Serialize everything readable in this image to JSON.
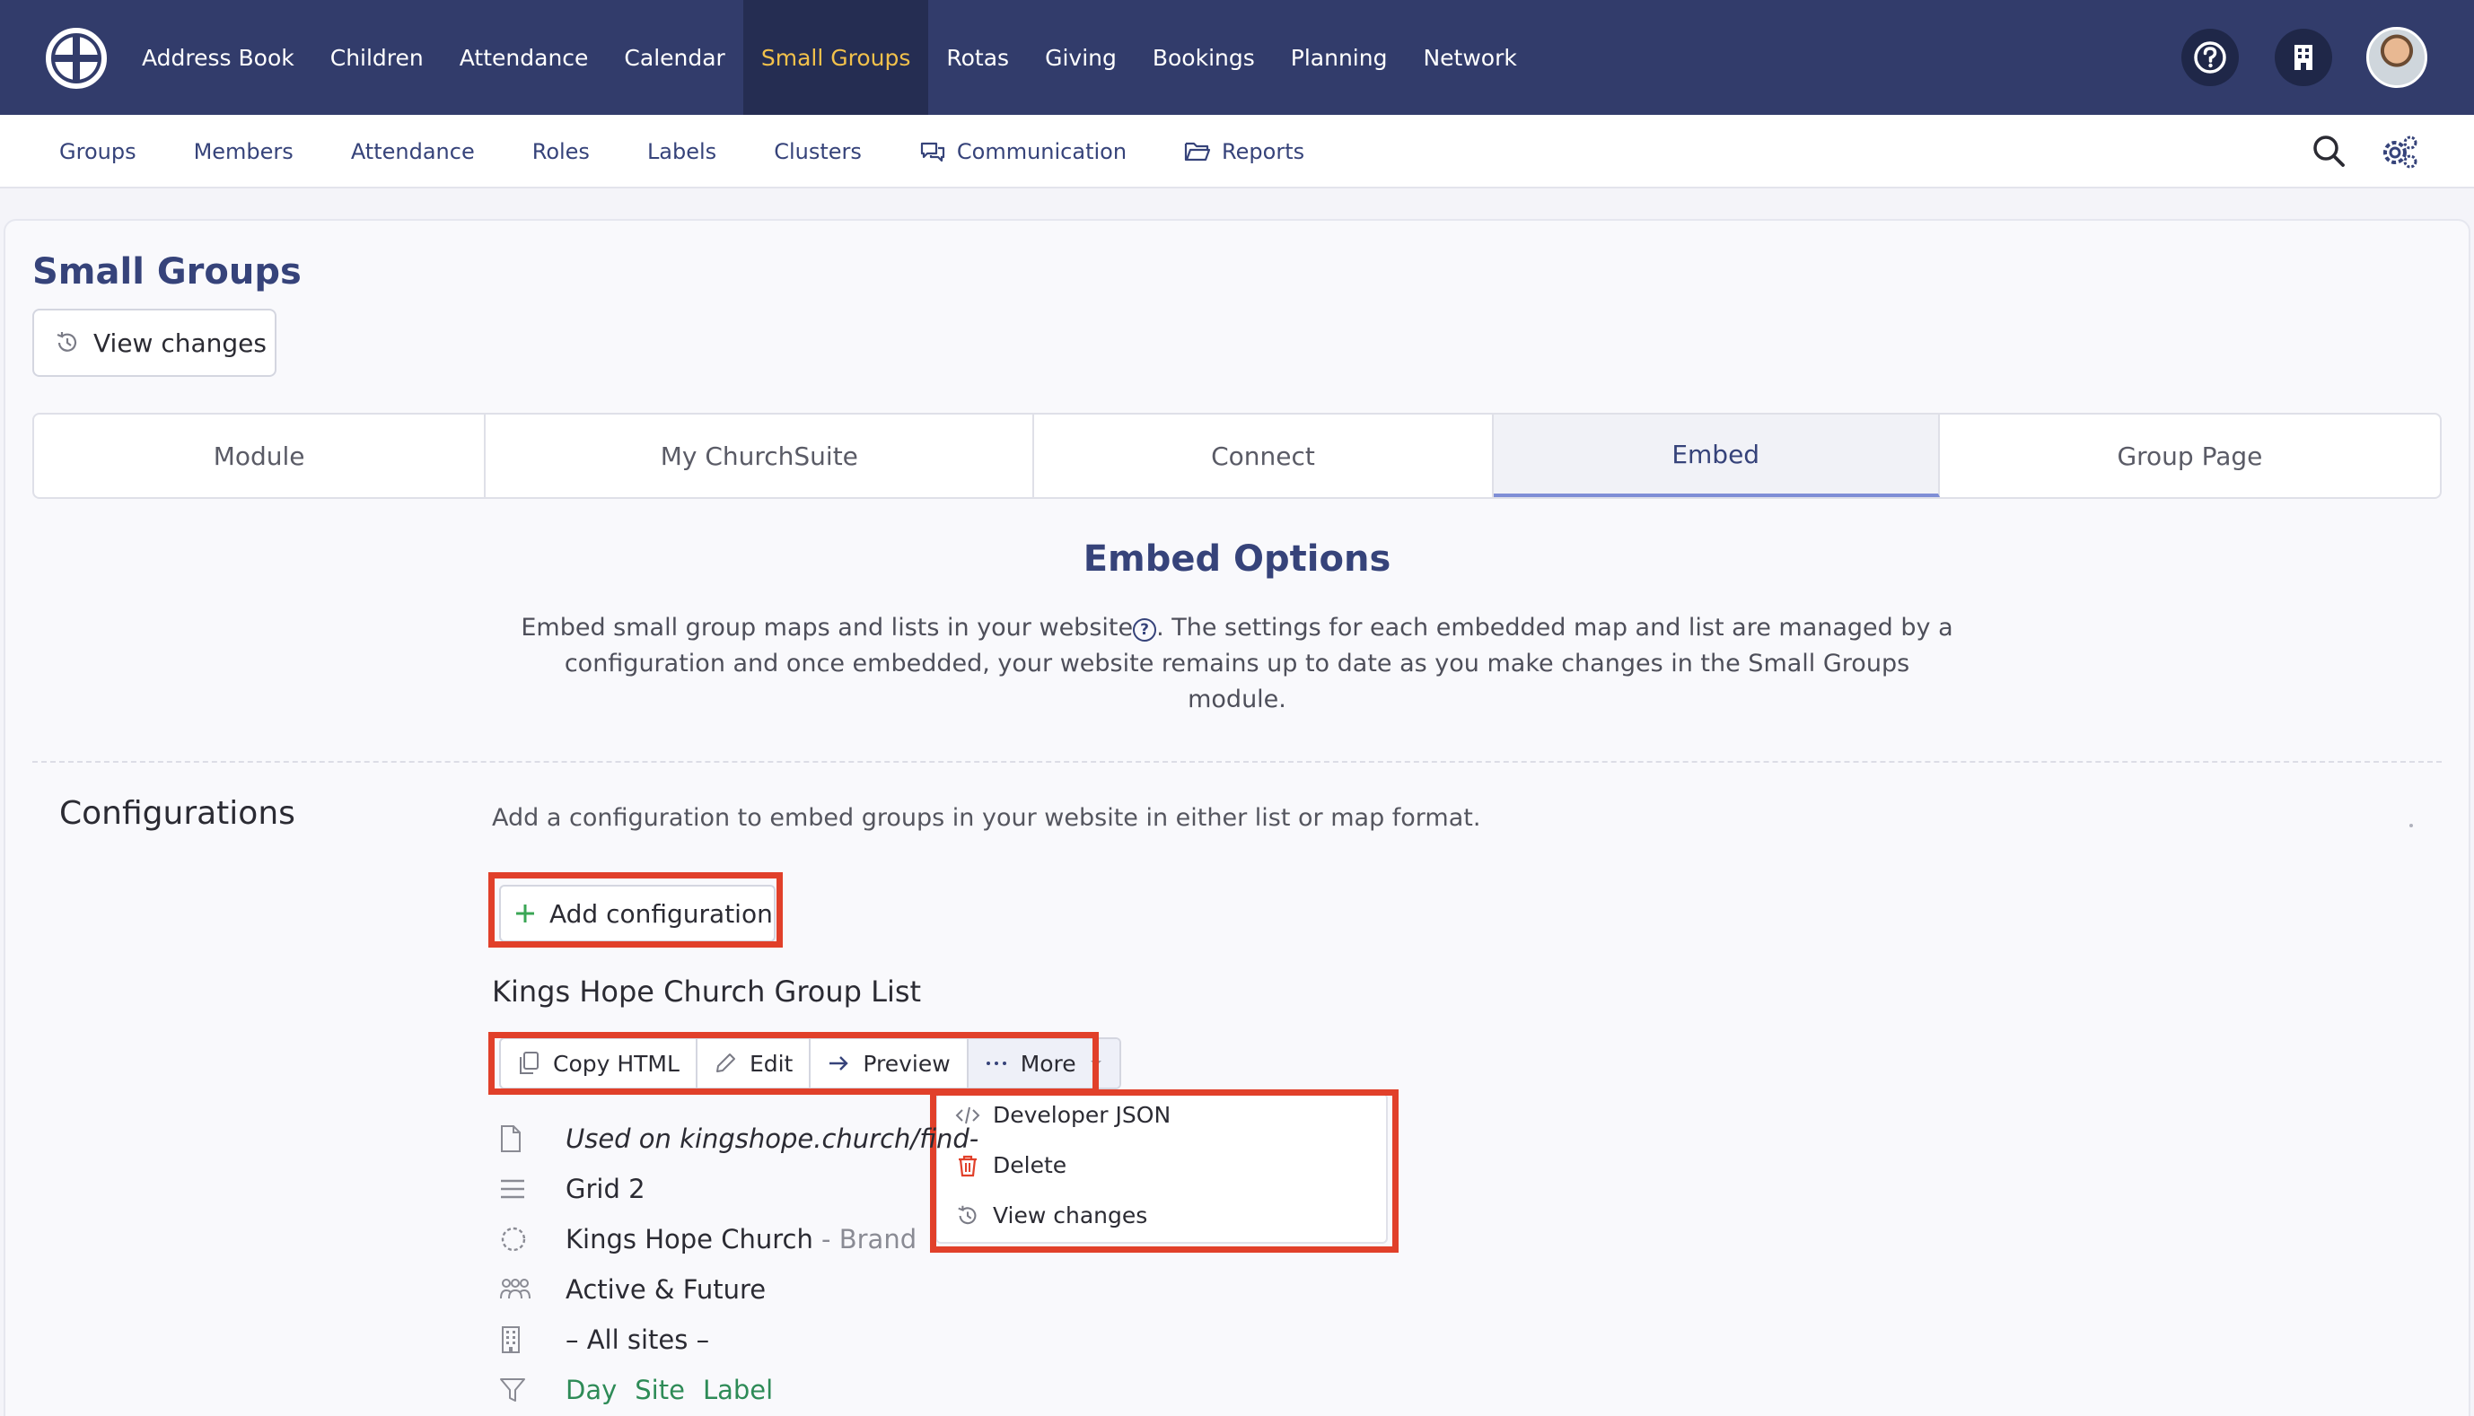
{
  "topnav": {
    "items": [
      {
        "label": "Address Book"
      },
      {
        "label": "Children"
      },
      {
        "label": "Attendance"
      },
      {
        "label": "Calendar"
      },
      {
        "label": "Small Groups",
        "active": true
      },
      {
        "label": "Rotas"
      },
      {
        "label": "Giving"
      },
      {
        "label": "Bookings"
      },
      {
        "label": "Planning"
      },
      {
        "label": "Network"
      }
    ],
    "active_color": "#f2c14b",
    "background": "#323c6b",
    "icons": [
      "churchsuite-logo-icon",
      "help-icon",
      "building-icon",
      "user-avatar"
    ]
  },
  "subnav": {
    "items": [
      {
        "label": "Groups"
      },
      {
        "label": "Members"
      },
      {
        "label": "Attendance"
      },
      {
        "label": "Roles"
      },
      {
        "label": "Labels"
      },
      {
        "label": "Clusters"
      },
      {
        "label": "Communication",
        "icon": "chat-icon"
      },
      {
        "label": "Reports",
        "icon": "folder-icon"
      }
    ],
    "icons": [
      "search-icon",
      "settings-icon"
    ]
  },
  "page": {
    "title": "Small Groups",
    "view_changes_label": "View changes"
  },
  "tabs": [
    {
      "label": "Module"
    },
    {
      "label": "My ChurchSuite"
    },
    {
      "label": "Connect"
    },
    {
      "label": "Embed",
      "active": true
    },
    {
      "label": "Group Page"
    }
  ],
  "embed": {
    "title": "Embed Options",
    "desc_part1": "Embed small group maps and lists in your website",
    "desc_part2": ". The settings for each embedded map and list are managed by a configuration and once embedded, your website remains up to date as you make changes in the Small Groups module.",
    "help_glyph": "?"
  },
  "configurations": {
    "heading": "Configurations",
    "description": "Add a configuration to embed groups in your website in either list or map format.",
    "add_label": "Add configuration",
    "item": {
      "name": "Kings Hope Church Group List",
      "actions": {
        "copy_html": "Copy HTML",
        "edit": "Edit",
        "preview": "Preview",
        "more": "More"
      },
      "more_menu": [
        {
          "label": "Developer JSON",
          "icon": "code-icon"
        },
        {
          "label": "Delete",
          "icon": "trash-icon",
          "color": "#e1402a"
        },
        {
          "label": "View changes",
          "icon": "history-icon"
        }
      ],
      "details": {
        "used_on": "Used on kingshope.church/find-",
        "layout": "Grid 2",
        "brand_name": "Kings Hope Church",
        "brand_suffix": "- Brand",
        "status": "Active & Future",
        "sites": "– All sites –",
        "filters": [
          "Day",
          "Site",
          "Label"
        ]
      }
    }
  },
  "highlight_color": "#e1402a"
}
